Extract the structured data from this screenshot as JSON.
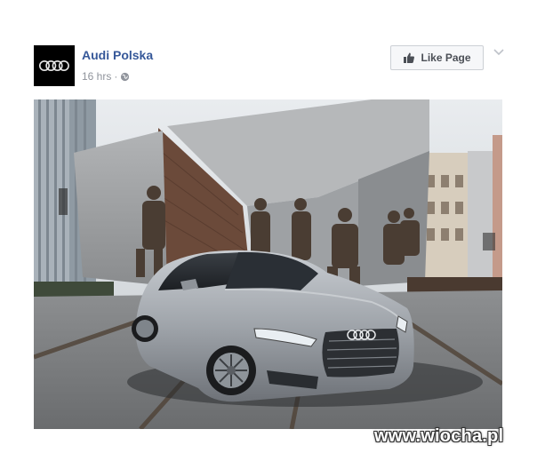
{
  "post": {
    "page_name": "Audi Polska",
    "timestamp": "16 hrs",
    "separator": "·",
    "privacy_icon": "globe-icon",
    "like_button_label": "Like Page",
    "like_icon": "thumbs-up-icon",
    "options_icon": "chevron-down-icon",
    "avatar_logo": "audi-rings-logo",
    "photo_subject": "grey-audi-a5-sportback-in-front-of-warsaw-uprising-monument"
  },
  "watermark": {
    "text": "www.wiocha.pl"
  },
  "colors": {
    "page_name": "#365899",
    "meta_text": "#90949c",
    "button_bg": "#f6f7f9",
    "button_border": "#ccd0d5",
    "button_text": "#4b4f56"
  }
}
